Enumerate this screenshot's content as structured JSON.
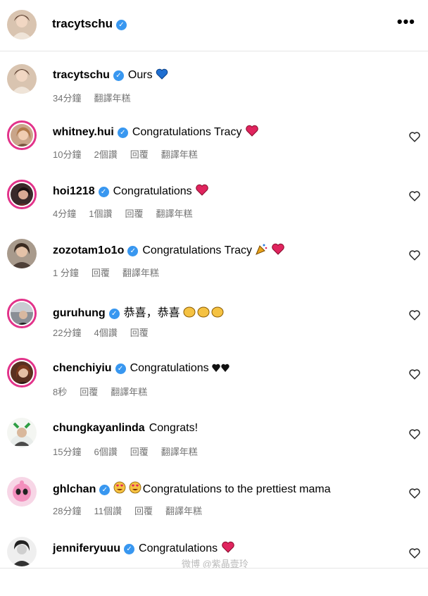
{
  "header": {
    "username": "tracytschu",
    "more_label": "•••"
  },
  "comments": [
    {
      "username": "tracytschu",
      "verified": true,
      "text": "Ours",
      "meta": [
        "34分鐘",
        "翻譯年糕"
      ],
      "likeable": false
    },
    {
      "username": "whitney.hui",
      "verified": true,
      "text": "Congratulations Tracy",
      "meta": [
        "10分鐘",
        "2個讚",
        "回覆",
        "翻譯年糕"
      ],
      "likeable": true
    },
    {
      "username": "hoi1218",
      "verified": true,
      "text": "Congratulations",
      "meta": [
        "4分鐘",
        "1個讚",
        "回覆",
        "翻譯年糕"
      ],
      "likeable": true
    },
    {
      "username": "zozotam1o1o",
      "verified": true,
      "text": "Congratulations Tracy",
      "meta": [
        "1 分鐘",
        "回覆",
        "翻譯年糕"
      ],
      "likeable": true
    },
    {
      "username": "guruhung",
      "verified": true,
      "text": "恭喜，恭喜",
      "meta": [
        "22分鐘",
        "4個讚",
        "回覆"
      ],
      "likeable": true
    },
    {
      "username": "chenchiyiu",
      "verified": true,
      "text": "Congratulations",
      "meta": [
        "8秒",
        "回覆",
        "翻譯年糕"
      ],
      "likeable": true
    },
    {
      "username": "chungkayanlinda",
      "verified": false,
      "text": "Congrats!",
      "meta": [
        "15分鐘",
        "6個讚",
        "回覆",
        "翻譯年糕"
      ],
      "likeable": true
    },
    {
      "username": "ghlchan",
      "verified": true,
      "text": "Congratulations to the prettiest mama",
      "meta": [
        "28分鐘",
        "11個讚",
        "回覆",
        "翻譯年糕"
      ],
      "likeable": true
    },
    {
      "username": "jenniferyuuu",
      "verified": true,
      "text": "Congratulations",
      "meta": [],
      "likeable": true
    }
  ],
  "watermark": "微博 @紫晶壹玲",
  "colors": {
    "verified": "#3897f0",
    "heart": "#e0245e",
    "story_ring": "#e2338a",
    "meta": "#737373"
  }
}
